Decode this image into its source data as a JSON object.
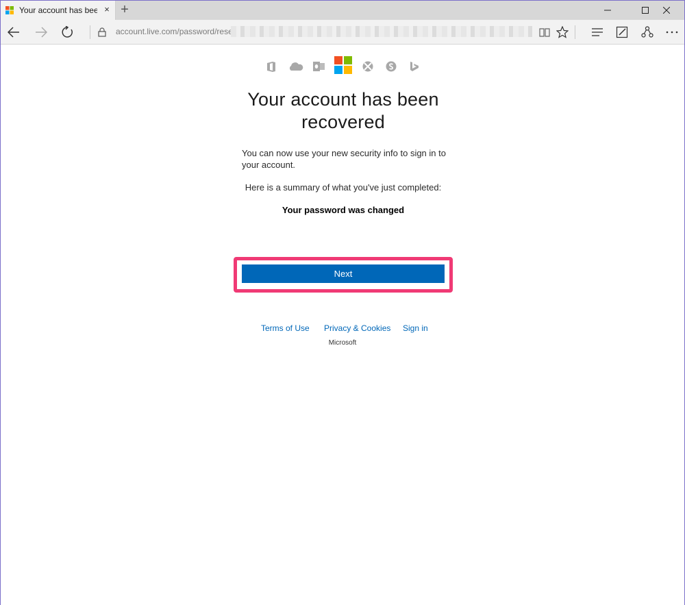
{
  "browser": {
    "tab_title": "Your account has been r",
    "tab_close": "×",
    "new_tab": "+",
    "address_url": "account.live.com/password/reset?"
  },
  "page": {
    "heading": "Your account has been recovered",
    "message": "You can now use your new security info to sign in to your account.",
    "summary_intro": "Here is a summary of what you've just completed:",
    "summary_item": "Your password was changed",
    "next_button": "Next",
    "highlight_color": "#f03a75",
    "button_color": "#0067b8"
  },
  "footer": {
    "links": [
      "Terms of Use",
      "Privacy & Cookies",
      "Sign in"
    ],
    "brand": "Microsoft"
  },
  "icons": [
    "office-icon",
    "onedrive-icon",
    "outlook-icon",
    "microsoft-logo",
    "xbox-icon",
    "skype-icon",
    "bing-icon"
  ]
}
